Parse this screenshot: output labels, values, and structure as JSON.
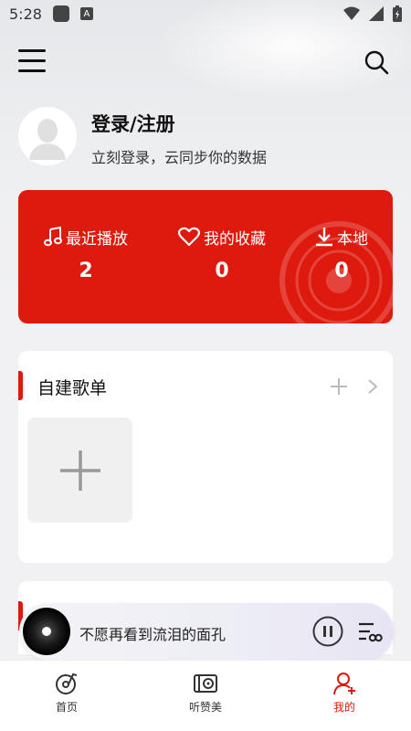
{
  "status_bar": {
    "time": "5:28",
    "notif_letter": "A"
  },
  "header": {
    "menu_icon": "menu-icon",
    "search_icon": "search-icon"
  },
  "user": {
    "title": "登录/注册",
    "subtitle": "立刻登录，云同步你的数据"
  },
  "stats": [
    {
      "label": "最近播放",
      "value": "2",
      "icon": "music-note-icon"
    },
    {
      "label": "我的收藏",
      "value": "0",
      "icon": "heart-icon"
    },
    {
      "label": "本地",
      "value": "0",
      "icon": "download-icon"
    }
  ],
  "playlists": {
    "title": "自建歌单"
  },
  "player": {
    "song": "不愿再看到流泪的面孔"
  },
  "tabs": [
    {
      "label": "首页",
      "icon": "music-disc-icon",
      "active": false
    },
    {
      "label": "听赞美",
      "icon": "radio-icon",
      "active": false
    },
    {
      "label": "我的",
      "icon": "user-icon",
      "active": true
    }
  ],
  "colors": {
    "accent": "#de1a0e",
    "background": "#f1f1f3"
  }
}
